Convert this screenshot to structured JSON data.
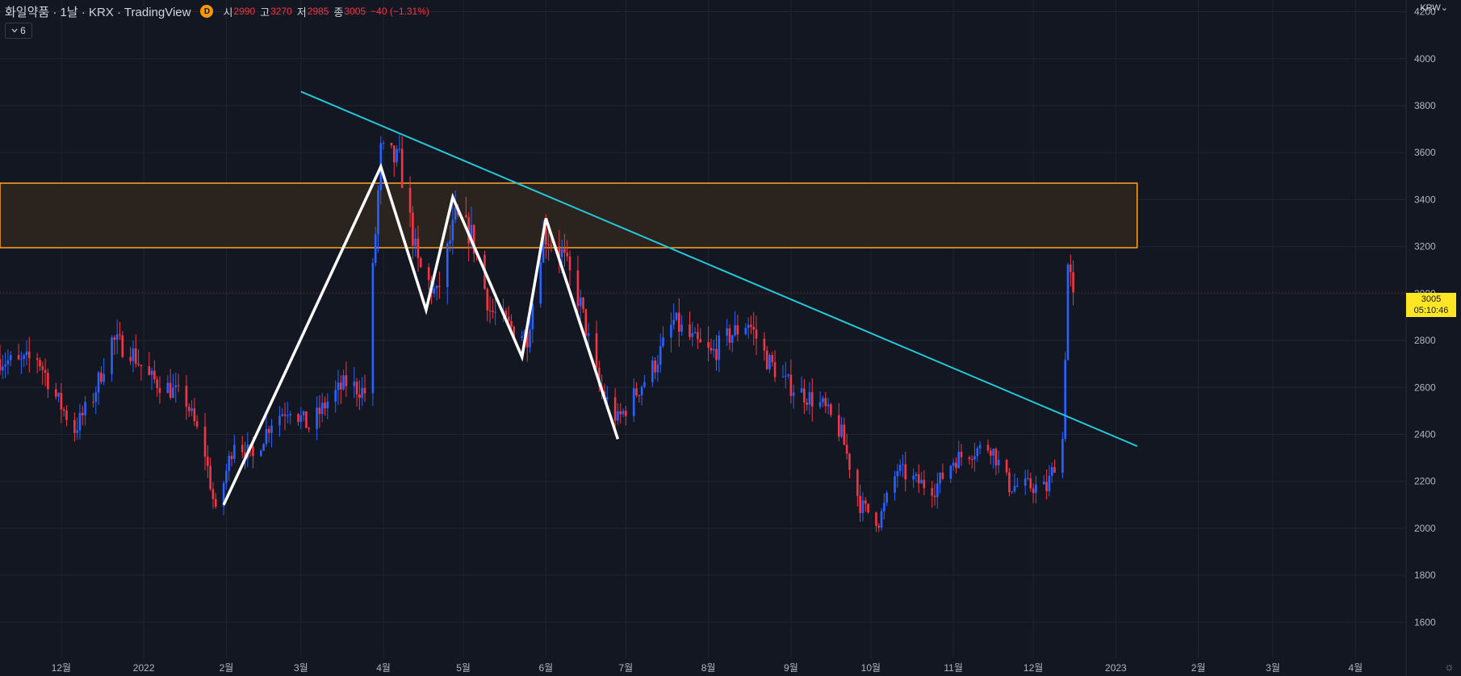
{
  "header": {
    "title": "화일약품 · 1날 · KRX · TradingView",
    "interval_badge": "D",
    "open_label": "시",
    "open_value": "2990",
    "high_label": "고",
    "high_value": "3270",
    "low_label": "저",
    "low_value": "2985",
    "close_label": "종",
    "close_value": "3005",
    "change": "−40 (−1.31%)"
  },
  "collapse_button": {
    "count": "6"
  },
  "currency": "KRW",
  "last_price": {
    "price": "3005",
    "countdown": "05:10:46"
  },
  "colors": {
    "background": "#131722",
    "grid": "#1f2430",
    "up": "#2962ff",
    "down": "#f23645",
    "trendline": "#26c6da",
    "zone_border": "#ffa726",
    "zone_fill": "#2b231e",
    "pattern": "#ffffff",
    "price_badge": "#ffe625"
  },
  "icons": {
    "chevron": "chevron-down-icon",
    "settings": "gear-icon"
  },
  "chart_data": {
    "type": "candlestick",
    "ylim": [
      1450,
      4250
    ],
    "y_ticks": [
      1600,
      1800,
      2000,
      2200,
      2400,
      2600,
      2800,
      3000,
      3200,
      3400,
      3600,
      3800,
      4000,
      4200
    ],
    "grid": true,
    "x_start": "2021-11-08",
    "x_end": "2023-04-20",
    "x_ticks": [
      {
        "label": "12월",
        "date": "2021-12-01"
      },
      {
        "label": "2022",
        "date": "2022-01-01"
      },
      {
        "label": "2월",
        "date": "2022-02-01"
      },
      {
        "label": "3월",
        "date": "2022-03-01"
      },
      {
        "label": "4월",
        "date": "2022-04-01"
      },
      {
        "label": "5월",
        "date": "2022-05-01"
      },
      {
        "label": "6월",
        "date": "2022-06-01"
      },
      {
        "label": "7월",
        "date": "2022-07-01"
      },
      {
        "label": "8월",
        "date": "2022-08-01"
      },
      {
        "label": "9월",
        "date": "2022-09-01"
      },
      {
        "label": "10월",
        "date": "2022-10-01"
      },
      {
        "label": "11월",
        "date": "2022-11-01"
      },
      {
        "label": "12월",
        "date": "2022-12-01"
      },
      {
        "label": "2023",
        "date": "2023-01-01"
      },
      {
        "label": "2월",
        "date": "2023-02-01"
      },
      {
        "label": "3월",
        "date": "2023-03-01"
      },
      {
        "label": "4월",
        "date": "2023-04-01"
      }
    ],
    "price_path": [
      [
        "2021-11-08",
        2720
      ],
      [
        "2021-11-15",
        2700
      ],
      [
        "2021-11-22",
        2730
      ],
      [
        "2021-11-29",
        2560
      ],
      [
        "2021-12-06",
        2420
      ],
      [
        "2021-12-13",
        2560
      ],
      [
        "2021-12-20",
        2800
      ],
      [
        "2021-12-27",
        2760
      ],
      [
        "2022-01-03",
        2640
      ],
      [
        "2022-01-10",
        2600
      ],
      [
        "2022-01-17",
        2540
      ],
      [
        "2022-01-24",
        2320
      ],
      [
        "2022-01-28",
        2060
      ],
      [
        "2022-02-04",
        2380
      ],
      [
        "2022-02-11",
        2300
      ],
      [
        "2022-02-18",
        2460
      ],
      [
        "2022-02-25",
        2520
      ],
      [
        "2022-03-04",
        2430
      ],
      [
        "2022-03-11",
        2540
      ],
      [
        "2022-03-18",
        2620
      ],
      [
        "2022-03-25",
        2580
      ],
      [
        "2022-03-31",
        3600
      ],
      [
        "2022-04-07",
        3560
      ],
      [
        "2022-04-14",
        3120
      ],
      [
        "2022-04-21",
        2990
      ],
      [
        "2022-04-28",
        3320
      ],
      [
        "2022-05-04",
        3250
      ],
      [
        "2022-05-11",
        2930
      ],
      [
        "2022-05-18",
        2860
      ],
      [
        "2022-05-25",
        2820
      ],
      [
        "2022-05-31",
        3260
      ],
      [
        "2022-06-07",
        3170
      ],
      [
        "2022-06-14",
        2950
      ],
      [
        "2022-06-21",
        2600
      ],
      [
        "2022-06-28",
        2460
      ],
      [
        "2022-07-05",
        2580
      ],
      [
        "2022-07-12",
        2700
      ],
      [
        "2022-07-19",
        2880
      ],
      [
        "2022-07-26",
        2800
      ],
      [
        "2022-08-02",
        2740
      ],
      [
        "2022-08-09",
        2820
      ],
      [
        "2022-08-16",
        2880
      ],
      [
        "2022-08-23",
        2720
      ],
      [
        "2022-08-30",
        2620
      ],
      [
        "2022-09-06",
        2570
      ],
      [
        "2022-09-13",
        2520
      ],
      [
        "2022-09-20",
        2400
      ],
      [
        "2022-09-27",
        2100
      ],
      [
        "2022-10-04",
        2030
      ],
      [
        "2022-10-11",
        2250
      ],
      [
        "2022-10-18",
        2200
      ],
      [
        "2022-10-25",
        2170
      ],
      [
        "2022-11-01",
        2290
      ],
      [
        "2022-11-08",
        2330
      ],
      [
        "2022-11-15",
        2350
      ],
      [
        "2022-11-22",
        2180
      ],
      [
        "2022-11-29",
        2180
      ],
      [
        "2022-12-06",
        2170
      ],
      [
        "2022-12-12",
        2380
      ],
      [
        "2022-12-14",
        3120
      ],
      [
        "2022-12-16",
        3005
      ]
    ],
    "resistance_zone": {
      "x_start": "2021-11-08",
      "x_end": "2023-01-09",
      "y_low": 3195,
      "y_high": 3470
    },
    "trendline": [
      [
        "2022-03-01",
        3860
      ],
      [
        "2023-01-09",
        2350
      ]
    ],
    "pattern_polyline": [
      [
        "2022-01-31",
        2100
      ],
      [
        "2022-03-31",
        3540
      ],
      [
        "2022-04-17",
        2930
      ],
      [
        "2022-04-27",
        3410
      ],
      [
        "2022-05-23",
        2730
      ],
      [
        "2022-06-01",
        3320
      ],
      [
        "2022-06-28",
        2380
      ]
    ]
  }
}
